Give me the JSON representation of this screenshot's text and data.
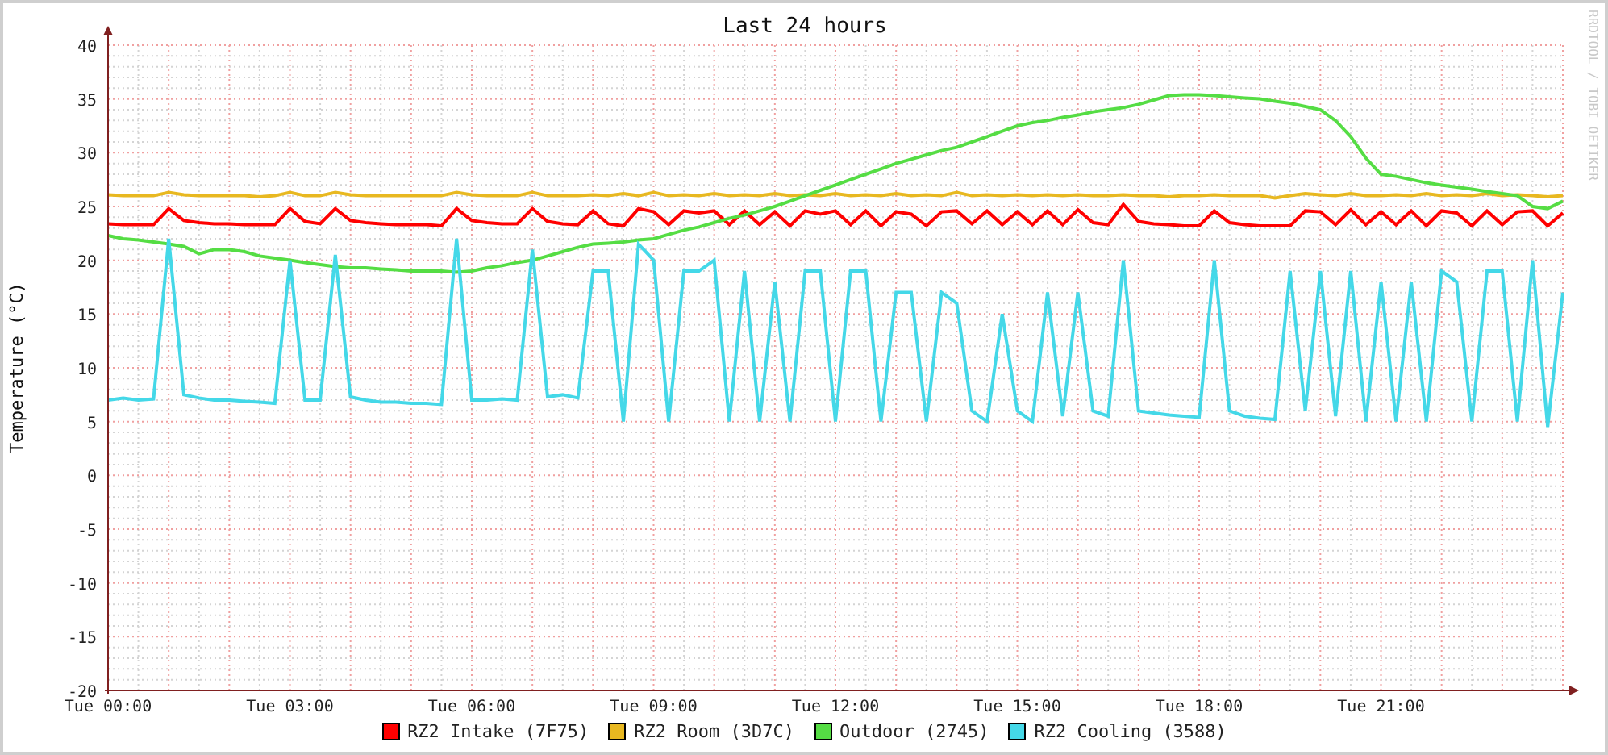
{
  "graph": {
    "credit": "RRDTOOL / TOBI OETIKER",
    "chart_data": {
      "type": "line",
      "grid": true,
      "title": "Last 24 hours",
      "ylabel": "Temperature (°C)",
      "ylim": [
        -20,
        40
      ],
      "yticks": [
        -20,
        -15,
        -10,
        -5,
        0,
        5,
        10,
        15,
        20,
        25,
        30,
        35,
        40
      ],
      "categories": [
        "Tue 00:00",
        null,
        null,
        null,
        null,
        null,
        null,
        null,
        null,
        null,
        null,
        null,
        "Tue 03:00",
        null,
        null,
        null,
        null,
        null,
        null,
        null,
        null,
        null,
        null,
        null,
        "Tue 06:00",
        null,
        null,
        null,
        null,
        null,
        null,
        null,
        null,
        null,
        null,
        null,
        "Tue 09:00",
        null,
        null,
        null,
        null,
        null,
        null,
        null,
        null,
        null,
        null,
        null,
        "Tue 12:00",
        null,
        null,
        null,
        null,
        null,
        null,
        null,
        null,
        null,
        null,
        null,
        "Tue 15:00",
        null,
        null,
        null,
        null,
        null,
        null,
        null,
        null,
        null,
        null,
        null,
        "Tue 18:00",
        null,
        null,
        null,
        null,
        null,
        null,
        null,
        null,
        null,
        null,
        null,
        "Tue 21:00",
        null,
        null,
        null,
        null,
        null,
        null,
        null,
        null,
        null,
        null,
        null,
        null
      ],
      "series": [
        {
          "name": "RZ2 Intake (7F75)",
          "color": "#ff0000",
          "values": [
            23.4,
            23.3,
            23.3,
            23.3,
            24.8,
            23.7,
            23.5,
            23.4,
            23.4,
            23.3,
            23.3,
            23.3,
            24.8,
            23.6,
            23.4,
            24.8,
            23.7,
            23.5,
            23.4,
            23.3,
            23.3,
            23.3,
            23.2,
            24.8,
            23.7,
            23.5,
            23.4,
            23.4,
            24.8,
            23.6,
            23.4,
            23.3,
            24.6,
            23.4,
            23.2,
            24.8,
            24.5,
            23.3,
            24.6,
            24.4,
            24.6,
            23.3,
            24.6,
            23.3,
            24.5,
            23.2,
            24.6,
            24.3,
            24.6,
            23.3,
            24.6,
            23.2,
            24.5,
            24.3,
            23.2,
            24.5,
            24.6,
            23.4,
            24.6,
            23.3,
            24.5,
            23.3,
            24.6,
            23.3,
            24.7,
            23.5,
            23.3,
            25.2,
            23.6,
            23.4,
            23.3,
            23.2,
            23.2,
            24.6,
            23.5,
            23.3,
            23.2,
            23.2,
            23.2,
            24.6,
            24.5,
            23.3,
            24.7,
            23.3,
            24.5,
            23.3,
            24.6,
            23.2,
            24.6,
            24.4,
            23.2,
            24.6,
            23.3,
            24.5,
            24.6,
            23.2,
            24.4
          ]
        },
        {
          "name": "RZ2 Room (3D7C)",
          "color": "#e8b820",
          "values": [
            26.1,
            26.0,
            26.0,
            26.0,
            26.3,
            26.1,
            26.0,
            26.0,
            26.0,
            26.0,
            25.9,
            26.0,
            26.3,
            26.0,
            26.0,
            26.3,
            26.1,
            26.0,
            26.0,
            26.0,
            26.0,
            26.0,
            26.0,
            26.3,
            26.1,
            26.0,
            26.0,
            26.0,
            26.3,
            26.0,
            26.0,
            26.0,
            26.1,
            26.0,
            26.2,
            26.0,
            26.3,
            26.0,
            26.1,
            26.0,
            26.2,
            26.0,
            26.1,
            26.0,
            26.2,
            26.0,
            26.1,
            26.0,
            26.2,
            26.0,
            26.1,
            26.0,
            26.2,
            26.0,
            26.1,
            26.0,
            26.3,
            26.0,
            26.1,
            26.0,
            26.1,
            26.0,
            26.1,
            26.0,
            26.1,
            26.0,
            26.0,
            26.1,
            26.0,
            26.0,
            25.9,
            26.0,
            26.0,
            26.1,
            26.0,
            26.0,
            26.0,
            25.8,
            26.0,
            26.2,
            26.1,
            26.0,
            26.2,
            26.0,
            26.0,
            26.1,
            26.0,
            26.2,
            26.0,
            26.1,
            26.0,
            26.2,
            26.0,
            26.1,
            26.0,
            25.9,
            26.0
          ]
        },
        {
          "name": "Outdoor (2745)",
          "color": "#55dd44",
          "values": [
            22.3,
            22.0,
            21.9,
            21.7,
            21.5,
            21.3,
            20.6,
            21.0,
            21.0,
            20.8,
            20.4,
            20.2,
            20.0,
            19.8,
            19.6,
            19.4,
            19.3,
            19.3,
            19.2,
            19.1,
            19.0,
            19.0,
            19.0,
            18.9,
            19.0,
            19.3,
            19.5,
            19.8,
            20.0,
            20.4,
            20.8,
            21.2,
            21.5,
            21.6,
            21.7,
            21.9,
            22.0,
            22.4,
            22.8,
            23.1,
            23.5,
            23.9,
            24.2,
            24.6,
            25.0,
            25.5,
            26.0,
            26.5,
            27.0,
            27.5,
            28.0,
            28.5,
            29.0,
            29.4,
            29.8,
            30.2,
            30.5,
            31.0,
            31.5,
            32.0,
            32.5,
            32.8,
            33.0,
            33.3,
            33.5,
            33.8,
            34.0,
            34.2,
            34.5,
            34.9,
            35.3,
            35.4,
            35.4,
            35.3,
            35.2,
            35.1,
            35.0,
            34.8,
            34.6,
            34.3,
            34.0,
            33.0,
            31.5,
            29.5,
            28.0,
            27.8,
            27.5,
            27.2,
            27.0,
            26.8,
            26.6,
            26.4,
            26.2,
            26.0,
            25.0,
            24.8,
            25.5
          ]
        },
        {
          "name": "RZ2 Cooling (3588)",
          "color": "#44d8e8",
          "values": [
            7,
            7.2,
            7,
            7.1,
            22,
            7.5,
            7.2,
            7,
            7,
            6.9,
            6.8,
            6.7,
            20,
            7,
            7,
            20.5,
            7.3,
            7,
            6.8,
            6.8,
            6.7,
            6.7,
            6.6,
            22,
            7,
            7,
            7.1,
            7,
            21,
            7.3,
            7.5,
            7.2,
            19,
            19,
            5,
            21.5,
            20,
            5,
            19,
            19,
            20,
            5,
            19,
            5,
            18,
            5,
            19,
            19,
            5,
            19,
            19,
            5,
            17,
            17,
            5,
            17,
            16,
            6,
            5,
            15,
            6,
            5,
            17,
            5.5,
            17,
            6,
            5.5,
            20,
            6,
            5.8,
            5.6,
            5.5,
            5.4,
            20,
            6,
            5.5,
            5.3,
            5.2,
            19,
            6,
            19,
            5.5,
            19,
            5,
            18,
            5,
            18,
            5,
            19,
            18,
            5,
            19,
            19,
            5,
            20,
            4.5,
            17
          ]
        }
      ]
    }
  }
}
